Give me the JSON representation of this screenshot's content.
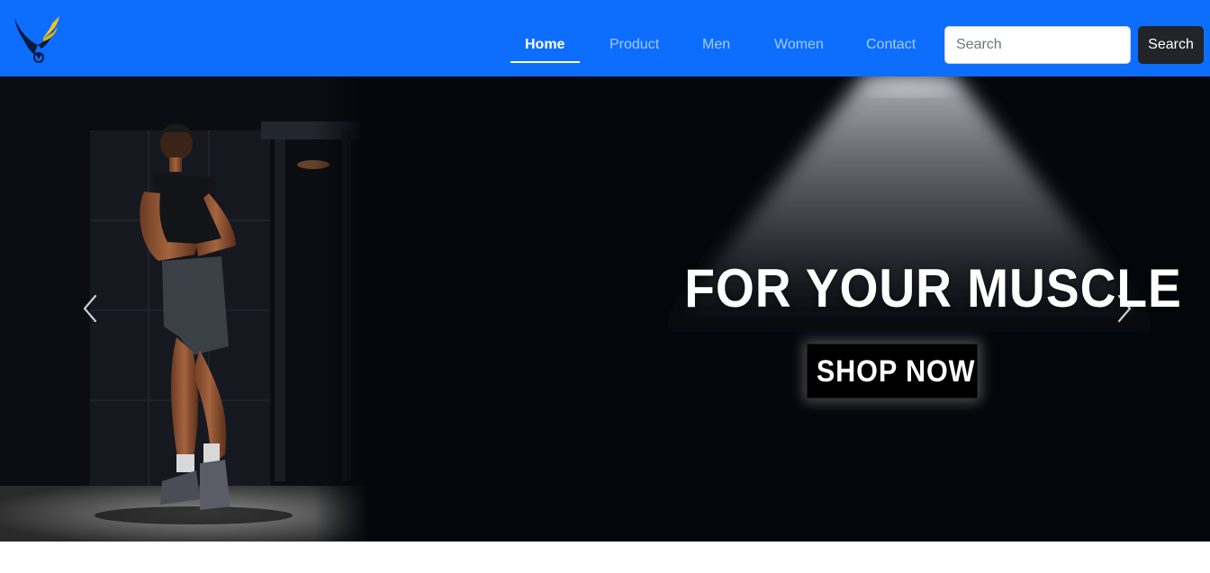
{
  "navbar": {
    "brand_colors": {
      "background": "#0d6efd",
      "logo_dark": "#0a1a3a",
      "logo_accent": "#f5c518"
    },
    "links": [
      {
        "label": "Home",
        "active": true
      },
      {
        "label": "Product",
        "active": false
      },
      {
        "label": "Men",
        "active": false
      },
      {
        "label": "Women",
        "active": false
      },
      {
        "label": "Contact",
        "active": false
      }
    ],
    "search": {
      "placeholder": "Search",
      "value": "",
      "button_label": "Search"
    }
  },
  "hero": {
    "headline": "FOR YOUR MUSCLE",
    "cta_label": "SHOP NOW",
    "background_color": "#04060b",
    "image_subject": "athlete-posing-in-dark-gym",
    "controls": {
      "prev_icon": "chevron-left-icon",
      "next_icon": "chevron-right-icon"
    }
  }
}
